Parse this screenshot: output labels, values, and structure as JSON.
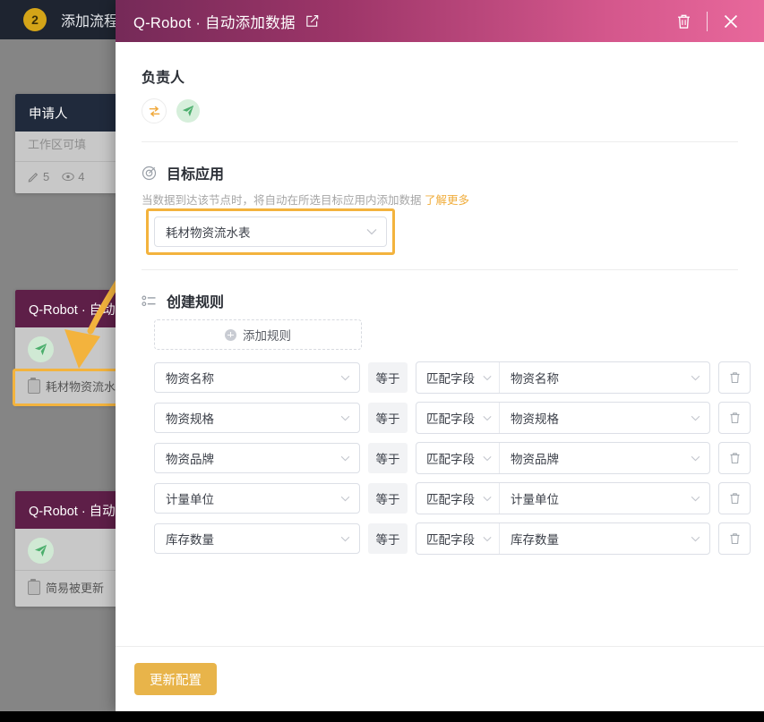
{
  "topbar": {
    "step_badge": "2",
    "title": "添加流程"
  },
  "canvas": {
    "cards": [
      {
        "header": "申请人",
        "subtitle": "工作区可填",
        "stat_edit": "5",
        "stat_view": "4"
      },
      {
        "header": "Q-Robot · 自动添加数据",
        "item": "耗材物资流水表"
      },
      {
        "header": "Q-Robot · 自动添加数据",
        "item": "简易被更新"
      }
    ]
  },
  "modal": {
    "title": "Q-Robot · 自动添加数据",
    "edit_icon": "edit-square-icon",
    "delete_icon": "trash-icon",
    "close_icon": "close-icon",
    "owner": {
      "title": "负责人",
      "avatars": [
        "swap-arrows-icon",
        "paper-plane-icon"
      ]
    },
    "target_app": {
      "icon": "target-icon",
      "title": "目标应用",
      "description": "当数据到达该节点时，将自动在所选目标应用内添加数据",
      "link": "了解更多",
      "select_value": "耗材物资流水表"
    },
    "rules": {
      "icon": "list-settings-icon",
      "title": "创建规则",
      "add_button": "添加规则",
      "operator_label": "等于",
      "match_type_label": "匹配字段",
      "rows": [
        {
          "field": "物资名称",
          "operator": "等于",
          "match_type": "匹配字段",
          "value": "物资名称"
        },
        {
          "field": "物资规格",
          "operator": "等于",
          "match_type": "匹配字段",
          "value": "物资规格"
        },
        {
          "field": "物资品牌",
          "operator": "等于",
          "match_type": "匹配字段",
          "value": "物资品牌"
        },
        {
          "field": "计量单位",
          "operator": "等于",
          "match_type": "匹配字段",
          "value": "计量单位"
        },
        {
          "field": "库存数量",
          "operator": "等于",
          "match_type": "匹配字段",
          "value": "库存数量"
        }
      ]
    },
    "footer": {
      "submit_label": "更新配置"
    }
  },
  "colors": {
    "header_gradient_start": "#752a58",
    "header_gradient_end": "#e8689b",
    "highlight": "#f3b33d",
    "accent_link": "#f0ad3c",
    "submit_button": "#e8b44a",
    "node_purple": "#5e1f48",
    "node_dark": "#202a3c"
  }
}
